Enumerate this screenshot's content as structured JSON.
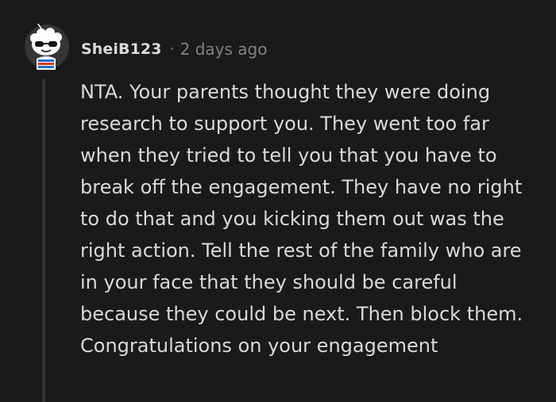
{
  "comment": {
    "author": "SheiB123",
    "separator": "·",
    "timestamp": "2 days ago",
    "avatar_icon": "snoo-avatar-with-sunglasses-icon",
    "body_paragraphs": [
      "NTA. Your parents thought they were doing research to support you. They went too far when they tried to tell you that you have to break off the engagement. They have no right to do that and you kicking them out was the right action. Tell the rest of the family who are in your face that they should be careful because they could be next. Then block them.",
      "Congratulations on your engagement"
    ]
  },
  "colors": {
    "background": "#1a1a1b",
    "text": "#d7dadc",
    "meta_text": "#818384",
    "thread_line": "#343536"
  }
}
